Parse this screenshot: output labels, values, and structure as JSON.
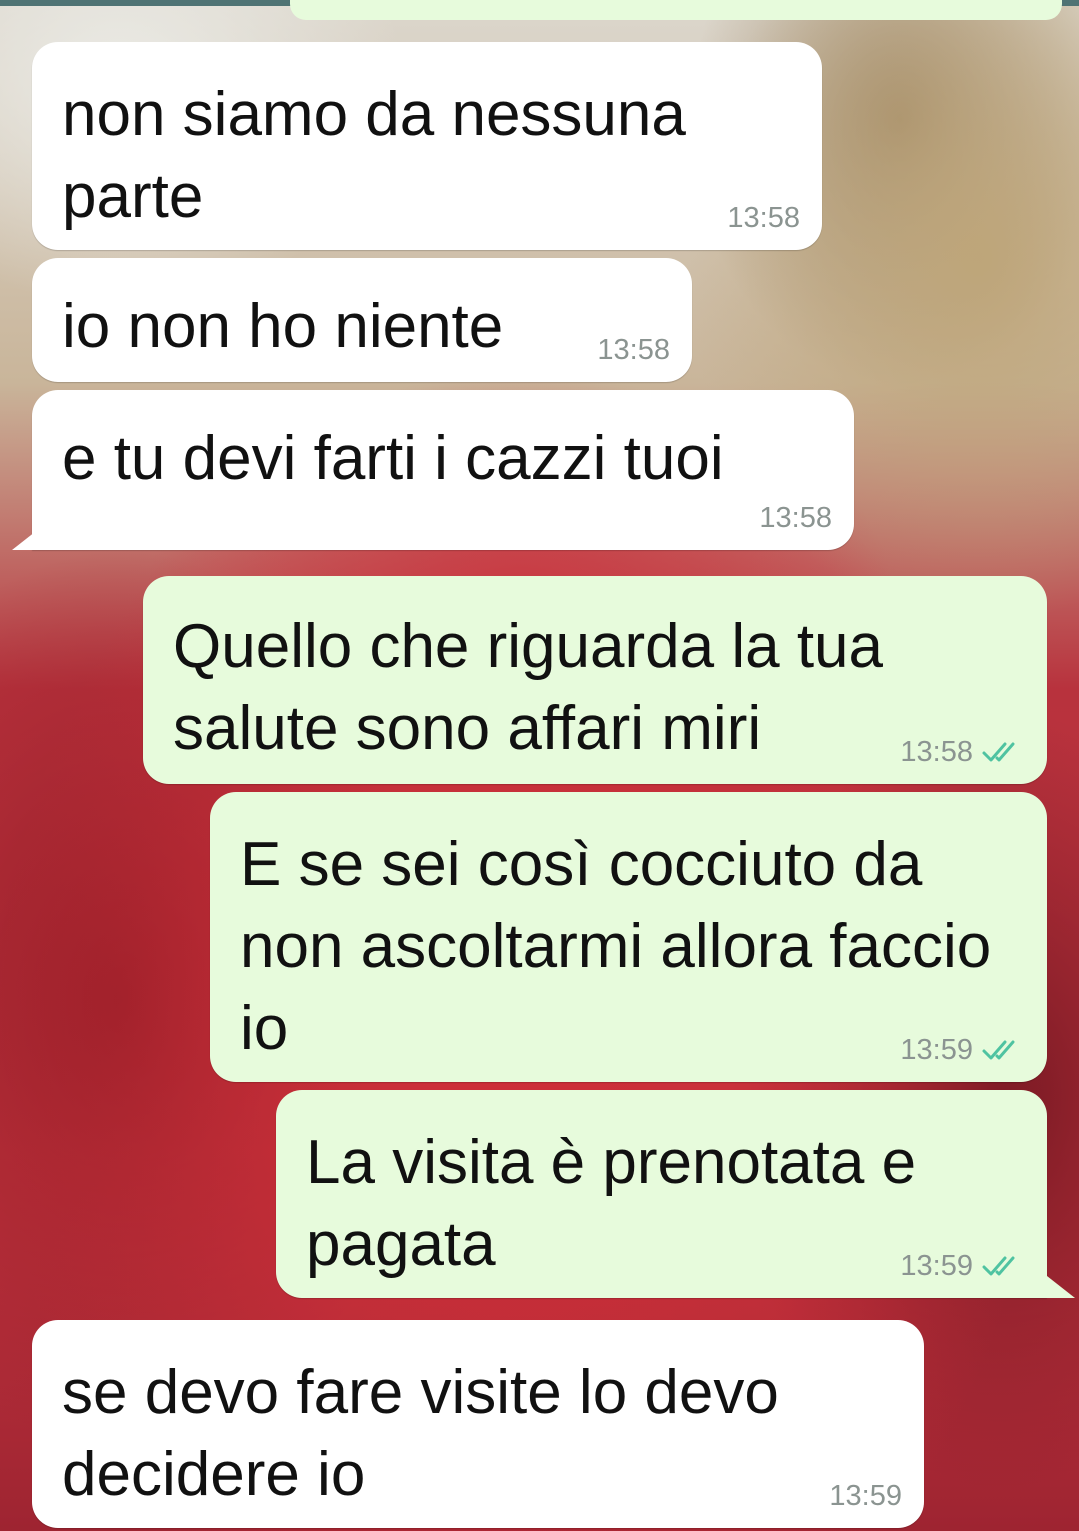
{
  "messages": [
    {
      "id": "m1",
      "direction": "incoming",
      "text": "non siamo da nessuna parte",
      "time": "13:58"
    },
    {
      "id": "m2",
      "direction": "incoming",
      "text": "io non ho niente",
      "time": "13:58"
    },
    {
      "id": "m3",
      "direction": "incoming",
      "text": "e tu devi farti i cazzi tuoi",
      "time": "13:58"
    },
    {
      "id": "m4",
      "direction": "outgoing",
      "text": "Quello che riguarda la tua salute sono affari miri",
      "time": "13:58",
      "status": "read"
    },
    {
      "id": "m5",
      "direction": "outgoing",
      "text": "E se sei così cocciuto da non ascoltarmi allora faccio io",
      "time": "13:59",
      "status": "read"
    },
    {
      "id": "m6",
      "direction": "outgoing",
      "text": "La visita è prenotata e pagata",
      "time": "13:59",
      "status": "read"
    },
    {
      "id": "m7",
      "direction": "incoming",
      "text": "se devo fare visite lo devo decidere io",
      "time": "13:59"
    }
  ],
  "colors": {
    "incoming_bubble": "#ffffff",
    "outgoing_bubble": "#e7fbdc",
    "read_check": "#4fc3a1",
    "timestamp": "#8b9491"
  },
  "icons": {
    "read_receipt": "double-check-icon"
  }
}
